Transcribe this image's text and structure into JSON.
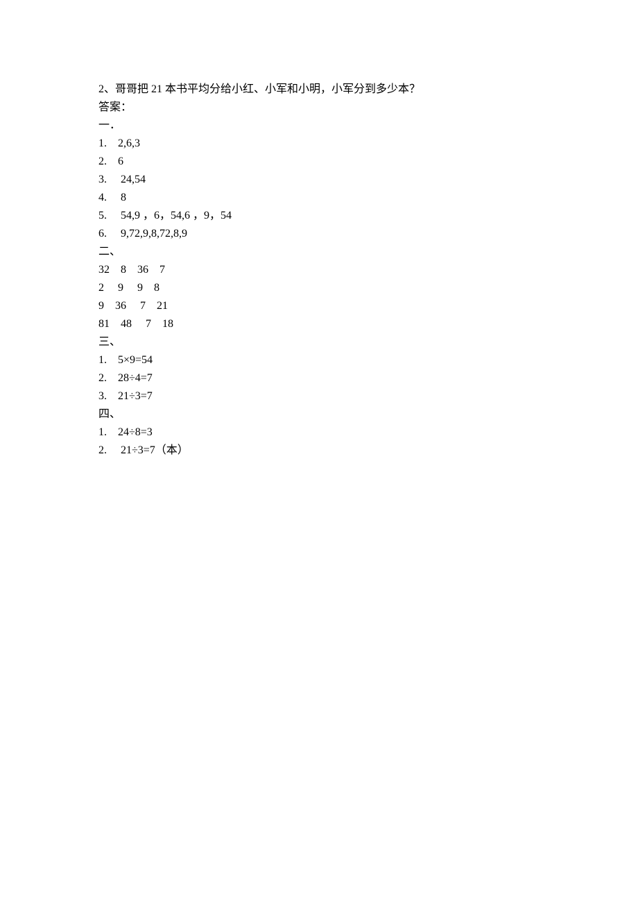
{
  "lines": {
    "q2": "2、哥哥把 21 本书平均分给小红、小军和小明，小军分到多少本？",
    "ans_label": "答案：",
    "s1_header": "一．",
    "s1_1": "1.　2,6,3",
    "s1_2": "2.　6",
    "s1_3": "3.　 24,54",
    "s1_4": "4.　 8",
    "s1_5": "5.　 54,9 ，6，54,6 ，9，54",
    "s1_6": "6.　 9,72,9,8,72,8,9",
    "s2_header": "二、",
    "s2_1": "32　8　36　7",
    "s2_2": "2　 9　 9　8",
    "s2_3": "9　36　 7　21",
    "s2_4": "81　48　 7　18",
    "s3_header": "三、",
    "s3_1": "1.　5×9=54",
    "s3_2": "2.　28÷4=7",
    "s3_3": "3.　21÷3=7",
    "s4_header": "四、",
    "s4_1": "1.　24÷8=3",
    "s4_2": "2.　 21÷3=7（本）"
  }
}
